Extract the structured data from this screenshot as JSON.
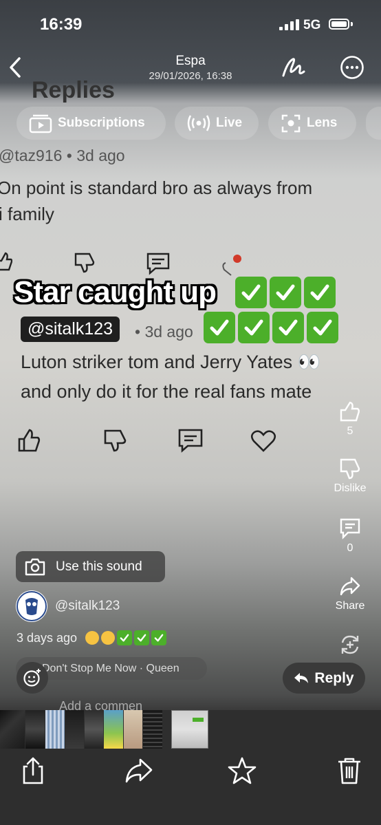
{
  "status_bar": {
    "time": "16:39",
    "network": "5G"
  },
  "nav": {
    "title": "Espa",
    "subtitle": "29/01/2026, 16:38"
  },
  "screen_content": {
    "heading": "Replies",
    "reply1_user": "@taz916 • 3d ago",
    "reply1_line1": "On point is standard bro as always from",
    "reply1_line2": "i family",
    "reply2_handle": "@sitalk123",
    "reply2_time": "• 3d ago",
    "reply2_line1": "Luton striker tom and Jerry Yates 👀",
    "reply2_line2": "and only do it for the real fans mate"
  },
  "chips": [
    {
      "label": "Subscriptions",
      "icon": "subscriptions-icon"
    },
    {
      "label": "Live",
      "icon": "live-icon"
    },
    {
      "label": "Lens",
      "icon": "lens-icon"
    }
  ],
  "overlay": {
    "caption": "Star caught up",
    "check_count_row1": 3,
    "check_count_row2": 4
  },
  "rail": {
    "like_count": "5",
    "dislike_label": "Dislike",
    "comment_count": "0",
    "share_label": "Share"
  },
  "sound": {
    "label": "Use this sound"
  },
  "post": {
    "author": "@sitalk123",
    "posted_ago": "3 days ago"
  },
  "music": {
    "track": "Don't Stop Me Now · Queen"
  },
  "comment_box": {
    "placeholder": "Add a commen"
  },
  "reply_button": {
    "label": "Reply"
  },
  "colors": {
    "check_green": "#4caf2a",
    "toolbar_bg": "#2e2e2e"
  }
}
